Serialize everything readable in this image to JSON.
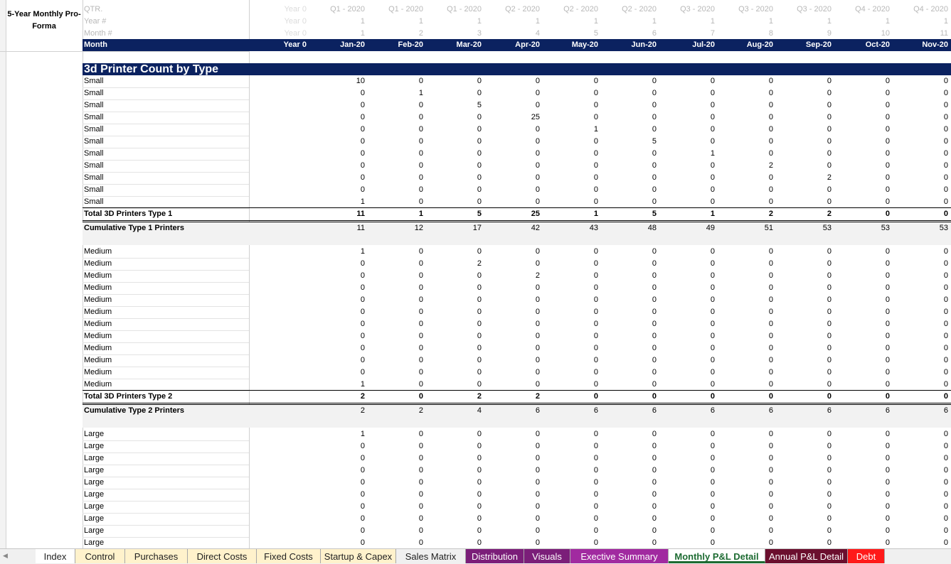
{
  "sheet": {
    "title": "5-Year Monthly Pro-Forma",
    "header_rows": [
      {
        "label": "QTR.",
        "values": [
          "Year 0",
          "Q1 - 2020",
          "Q1 - 2020",
          "Q1 - 2020",
          "Q2 - 2020",
          "Q2 - 2020",
          "Q2 - 2020",
          "Q3 - 2020",
          "Q3 - 2020",
          "Q3 - 2020",
          "Q4 - 2020",
          "Q4 - 2020"
        ]
      },
      {
        "label": "Year #",
        "values": [
          "Year 0",
          "1",
          "1",
          "1",
          "1",
          "1",
          "1",
          "1",
          "1",
          "1",
          "1",
          "1"
        ]
      },
      {
        "label": "Month #",
        "values": [
          "Year 0",
          "1",
          "2",
          "3",
          "4",
          "5",
          "6",
          "7",
          "8",
          "9",
          "10",
          "11"
        ]
      }
    ],
    "month_row": {
      "label": "Month",
      "values": [
        "Year 0",
        "Jan-20",
        "Feb-20",
        "Mar-20",
        "Apr-20",
        "May-20",
        "Jun-20",
        "Jul-20",
        "Aug-20",
        "Sep-20",
        "Oct-20",
        "Nov-20"
      ]
    },
    "section_title": "3d Printer Count by Type",
    "small_rows": [
      {
        "label": "Small",
        "values": [
          "10",
          "0",
          "0",
          "0",
          "0",
          "0",
          "0",
          "0",
          "0",
          "0",
          "0"
        ]
      },
      {
        "label": "Small",
        "values": [
          "0",
          "1",
          "0",
          "0",
          "0",
          "0",
          "0",
          "0",
          "0",
          "0",
          "0"
        ]
      },
      {
        "label": "Small",
        "values": [
          "0",
          "0",
          "5",
          "0",
          "0",
          "0",
          "0",
          "0",
          "0",
          "0",
          "0"
        ]
      },
      {
        "label": "Small",
        "values": [
          "0",
          "0",
          "0",
          "25",
          "0",
          "0",
          "0",
          "0",
          "0",
          "0",
          "0"
        ]
      },
      {
        "label": "Small",
        "values": [
          "0",
          "0",
          "0",
          "0",
          "1",
          "0",
          "0",
          "0",
          "0",
          "0",
          "0"
        ]
      },
      {
        "label": "Small",
        "values": [
          "0",
          "0",
          "0",
          "0",
          "0",
          "5",
          "0",
          "0",
          "0",
          "0",
          "0"
        ]
      },
      {
        "label": "Small",
        "values": [
          "0",
          "0",
          "0",
          "0",
          "0",
          "0",
          "1",
          "0",
          "0",
          "0",
          "0"
        ]
      },
      {
        "label": "Small",
        "values": [
          "0",
          "0",
          "0",
          "0",
          "0",
          "0",
          "0",
          "2",
          "0",
          "0",
          "0"
        ]
      },
      {
        "label": "Small",
        "values": [
          "0",
          "0",
          "0",
          "0",
          "0",
          "0",
          "0",
          "0",
          "2",
          "0",
          "0"
        ]
      },
      {
        "label": "Small",
        "values": [
          "0",
          "0",
          "0",
          "0",
          "0",
          "0",
          "0",
          "0",
          "0",
          "0",
          "0"
        ]
      },
      {
        "label": "Small",
        "values": [
          "1",
          "0",
          "0",
          "0",
          "0",
          "0",
          "0",
          "0",
          "0",
          "0",
          "0"
        ]
      }
    ],
    "total1": {
      "label": "Total 3D Printers Type 1",
      "values": [
        "11",
        "1",
        "5",
        "25",
        "1",
        "5",
        "1",
        "2",
        "2",
        "0",
        "0"
      ]
    },
    "cum1": {
      "label": "Cumulative Type 1 Printers",
      "values": [
        "11",
        "12",
        "17",
        "42",
        "43",
        "48",
        "49",
        "51",
        "53",
        "53",
        "53"
      ]
    },
    "medium_rows": [
      {
        "label": "Medium",
        "values": [
          "1",
          "0",
          "0",
          "0",
          "0",
          "0",
          "0",
          "0",
          "0",
          "0",
          "0"
        ]
      },
      {
        "label": "Medium",
        "values": [
          "0",
          "0",
          "2",
          "0",
          "0",
          "0",
          "0",
          "0",
          "0",
          "0",
          "0"
        ]
      },
      {
        "label": "Medium",
        "values": [
          "0",
          "0",
          "0",
          "2",
          "0",
          "0",
          "0",
          "0",
          "0",
          "0",
          "0"
        ]
      },
      {
        "label": "Medium",
        "values": [
          "0",
          "0",
          "0",
          "0",
          "0",
          "0",
          "0",
          "0",
          "0",
          "0",
          "0"
        ]
      },
      {
        "label": "Medium",
        "values": [
          "0",
          "0",
          "0",
          "0",
          "0",
          "0",
          "0",
          "0",
          "0",
          "0",
          "0"
        ]
      },
      {
        "label": "Medium",
        "values": [
          "0",
          "0",
          "0",
          "0",
          "0",
          "0",
          "0",
          "0",
          "0",
          "0",
          "0"
        ]
      },
      {
        "label": "Medium",
        "values": [
          "0",
          "0",
          "0",
          "0",
          "0",
          "0",
          "0",
          "0",
          "0",
          "0",
          "0"
        ]
      },
      {
        "label": "Medium",
        "values": [
          "0",
          "0",
          "0",
          "0",
          "0",
          "0",
          "0",
          "0",
          "0",
          "0",
          "0"
        ]
      },
      {
        "label": "Medium",
        "values": [
          "0",
          "0",
          "0",
          "0",
          "0",
          "0",
          "0",
          "0",
          "0",
          "0",
          "0"
        ]
      },
      {
        "label": "Medium",
        "values": [
          "0",
          "0",
          "0",
          "0",
          "0",
          "0",
          "0",
          "0",
          "0",
          "0",
          "0"
        ]
      },
      {
        "label": "Medium",
        "values": [
          "0",
          "0",
          "0",
          "0",
          "0",
          "0",
          "0",
          "0",
          "0",
          "0",
          "0"
        ]
      },
      {
        "label": "Medium",
        "values": [
          "1",
          "0",
          "0",
          "0",
          "0",
          "0",
          "0",
          "0",
          "0",
          "0",
          "0"
        ]
      }
    ],
    "total2": {
      "label": "Total 3D Printers Type 2",
      "values": [
        "2",
        "0",
        "2",
        "2",
        "0",
        "0",
        "0",
        "0",
        "0",
        "0",
        "0"
      ]
    },
    "cum2": {
      "label": "Cumulative Type 2 Printers",
      "values": [
        "2",
        "2",
        "4",
        "6",
        "6",
        "6",
        "6",
        "6",
        "6",
        "6",
        "6"
      ]
    },
    "large_rows": [
      {
        "label": "Large",
        "values": [
          "1",
          "0",
          "0",
          "0",
          "0",
          "0",
          "0",
          "0",
          "0",
          "0",
          "0"
        ]
      },
      {
        "label": "Large",
        "values": [
          "0",
          "0",
          "0",
          "0",
          "0",
          "0",
          "0",
          "0",
          "0",
          "0",
          "0"
        ]
      },
      {
        "label": "Large",
        "values": [
          "0",
          "0",
          "0",
          "0",
          "0",
          "0",
          "0",
          "0",
          "0",
          "0",
          "0"
        ]
      },
      {
        "label": "Large",
        "values": [
          "0",
          "0",
          "0",
          "0",
          "0",
          "0",
          "0",
          "0",
          "0",
          "0",
          "0"
        ]
      },
      {
        "label": "Large",
        "values": [
          "0",
          "0",
          "0",
          "0",
          "0",
          "0",
          "0",
          "0",
          "0",
          "0",
          "0"
        ]
      },
      {
        "label": "Large",
        "values": [
          "0",
          "0",
          "0",
          "0",
          "0",
          "0",
          "0",
          "0",
          "0",
          "0",
          "0"
        ]
      },
      {
        "label": "Large",
        "values": [
          "0",
          "0",
          "0",
          "0",
          "0",
          "0",
          "0",
          "0",
          "0",
          "0",
          "0"
        ]
      },
      {
        "label": "Large",
        "values": [
          "0",
          "0",
          "0",
          "0",
          "0",
          "0",
          "0",
          "0",
          "0",
          "0",
          "0"
        ]
      },
      {
        "label": "Large",
        "values": [
          "0",
          "0",
          "0",
          "0",
          "0",
          "0",
          "0",
          "0",
          "0",
          "0",
          "0"
        ]
      },
      {
        "label": "Large",
        "values": [
          "0",
          "0",
          "0",
          "0",
          "0",
          "0",
          "0",
          "0",
          "0",
          "0",
          "0"
        ]
      }
    ]
  },
  "tabs": [
    {
      "label": "Index",
      "bg": "#ffffff",
      "color": "#222222"
    },
    {
      "label": "Control",
      "bg": "#fff2cc",
      "color": "#222222"
    },
    {
      "label": "Purchases",
      "bg": "#fff2cc",
      "color": "#222222"
    },
    {
      "label": "Direct Costs",
      "bg": "#fff2cc",
      "color": "#222222"
    },
    {
      "label": "Fixed Costs",
      "bg": "#fff2cc",
      "color": "#222222"
    },
    {
      "label": "Startup & Capex",
      "bg": "#fff2cc",
      "color": "#222222"
    },
    {
      "label": "Sales Matrix",
      "bg": "#f0f0f0",
      "color": "#222222"
    },
    {
      "label": "Distribution",
      "bg": "#7b1e79",
      "color": "#ffffff"
    },
    {
      "label": "Visuals",
      "bg": "#7b1e79",
      "color": "#ffffff"
    },
    {
      "label": "Exective Summary",
      "bg": "#a12aa0",
      "color": "#ffffff"
    },
    {
      "label": "Monthly P&L Detail",
      "bg": "#ffffff",
      "color": "#1d6b32",
      "active": true
    },
    {
      "label": "Annual P&L Detail",
      "bg": "#6b0f2e",
      "color": "#ffffff"
    },
    {
      "label": "Debt",
      "bg": "#ff1a1a",
      "color": "#ffffff"
    }
  ]
}
